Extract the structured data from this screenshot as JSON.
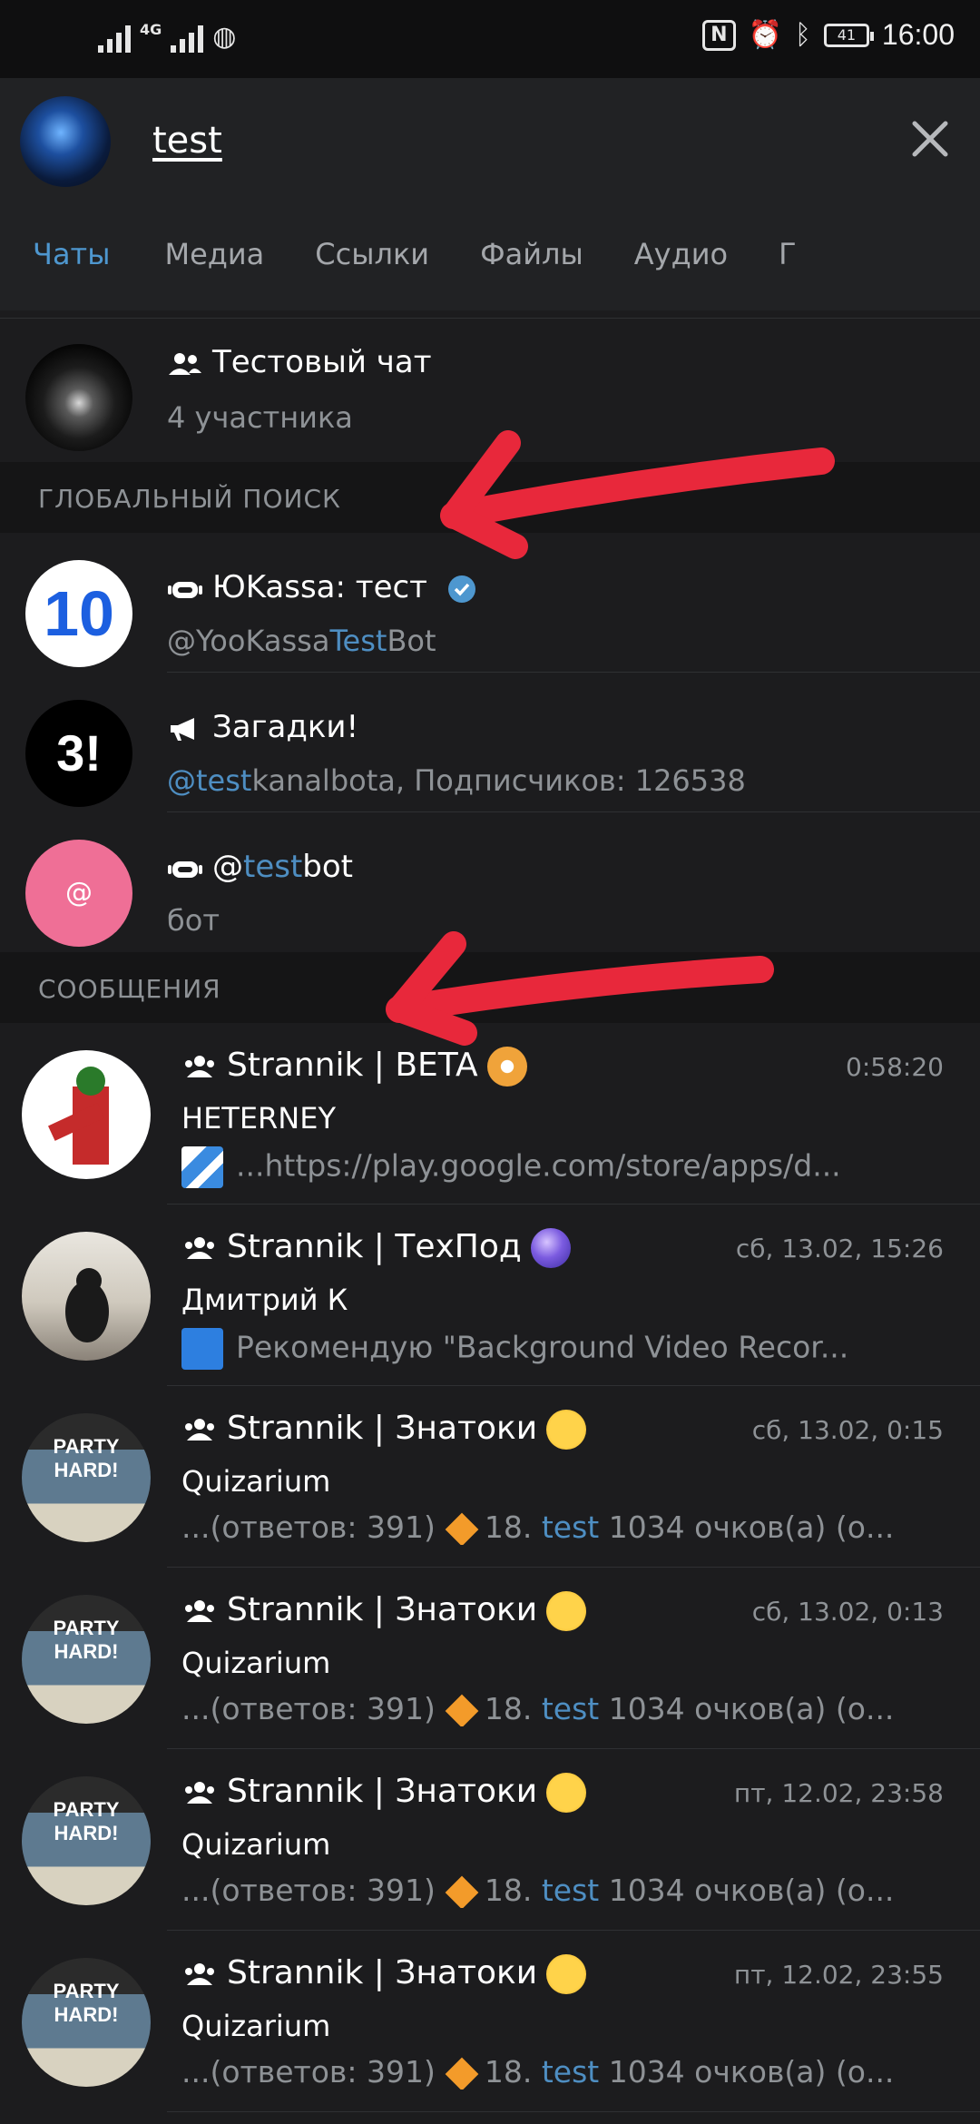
{
  "status_bar": {
    "net_label": "4G",
    "battery": "41",
    "time": "16:00"
  },
  "search": {
    "query": "test"
  },
  "tabs": [
    "Чаты",
    "Медиа",
    "Ссылки",
    "Файлы",
    "Аудио",
    "Г"
  ],
  "local_results": [
    {
      "title": "Тестовый чат",
      "subtitle": "4 участника",
      "icon": "group-icon",
      "avatar": "raccoon"
    }
  ],
  "global_header": "ГЛОБАЛЬНЫЙ ПОИСК",
  "global_results": [
    {
      "icon": "bot-icon",
      "title": "ЮKassa: тест",
      "verified": true,
      "sub_a": "@YooKassa",
      "sub_hl": "Test",
      "sub_b": "Bot",
      "avatar_text": "10"
    },
    {
      "icon": "megaphone-icon",
      "title": "Загадки!",
      "sub_a": "",
      "sub_hl": "@test",
      "sub_b": "kanalbota, Подписчиков: 126538",
      "avatar_text": "3!"
    },
    {
      "icon": "bot-icon",
      "title_a": "@",
      "title_hl": "test",
      "title_b": "bot",
      "sub": "бот",
      "avatar_text": "@"
    }
  ],
  "messages_header": "СООБЩЕНИЯ",
  "messages": [
    {
      "chat": "Strannik | BETA",
      "time": "0:58:20",
      "sender": "HETERNEY",
      "preview": "...https://play.google.com/store/apps/d...",
      "emoji": "flower"
    },
    {
      "chat": "Strannik | ТехПод",
      "time": "сб, 13.02, 15:26",
      "sender": "Дмитрий К",
      "preview": "Рекомендую \"Background Video Recor...",
      "emoji": "crystal-ball"
    },
    {
      "chat": "Strannik | Знатоки",
      "time": "сб, 13.02, 0:15",
      "sender": "Quizarium",
      "pre_a": "...(ответов: 391)",
      "pre_b": "18. ",
      "pre_hl": "test",
      "pre_c": " 1034 очков(а) (о...",
      "emoji": "nerd-face"
    },
    {
      "chat": "Strannik | Знатоки",
      "time": "сб, 13.02, 0:13",
      "sender": "Quizarium",
      "pre_a": "...(ответов: 391)",
      "pre_b": "18. ",
      "pre_hl": "test",
      "pre_c": " 1034 очков(а) (о...",
      "emoji": "nerd-face"
    },
    {
      "chat": "Strannik | Знатоки",
      "time": "пт, 12.02, 23:58",
      "sender": "Quizarium",
      "pre_a": "...(ответов: 391)",
      "pre_b": "18. ",
      "pre_hl": "test",
      "pre_c": " 1034 очков(а) (о...",
      "emoji": "nerd-face"
    },
    {
      "chat": "Strannik | Знатоки",
      "time": "пт, 12.02, 23:55",
      "sender": "Quizarium",
      "pre_a": "...(ответов: 391)",
      "pre_b": "18. ",
      "pre_hl": "test",
      "pre_c": " 1034 очков(а) (о...",
      "emoji": "nerd-face"
    }
  ],
  "colors": {
    "accent": "#4e97cf",
    "highlight": "#4e8ec2",
    "annotation_arrow": "#e8283b"
  }
}
